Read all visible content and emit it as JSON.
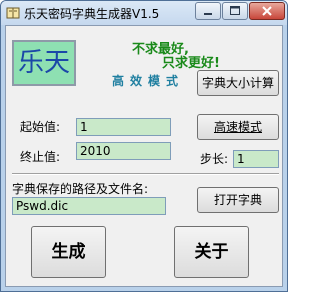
{
  "window": {
    "title": "乐天密码字典生成器V1.5",
    "colors": {
      "accent_green": "#1a8a1a",
      "field_bg": "#c9e9c9",
      "logo_bg": "#8ee0b2",
      "logo_text": "#1b47a8",
      "mode_text": "#1f7fa0"
    }
  },
  "header": {
    "logo_text": "乐天",
    "slogan_line1": "不求最好,",
    "slogan_line2": "只求更好!",
    "mode_label": "高效模式"
  },
  "form": {
    "start_label": "起始值:",
    "start_value": "1",
    "end_label": "终止值:",
    "end_value": "2010",
    "step_label": "步长:",
    "step_value": "1",
    "path_label": "字典保存的路径及文件名:",
    "path_value": "Pswd.dic"
  },
  "buttons": {
    "calc_size": "字典大小计算",
    "fast_mode": "高速模式",
    "open_dict": "打开字典",
    "generate": "生成",
    "about": "关于"
  }
}
